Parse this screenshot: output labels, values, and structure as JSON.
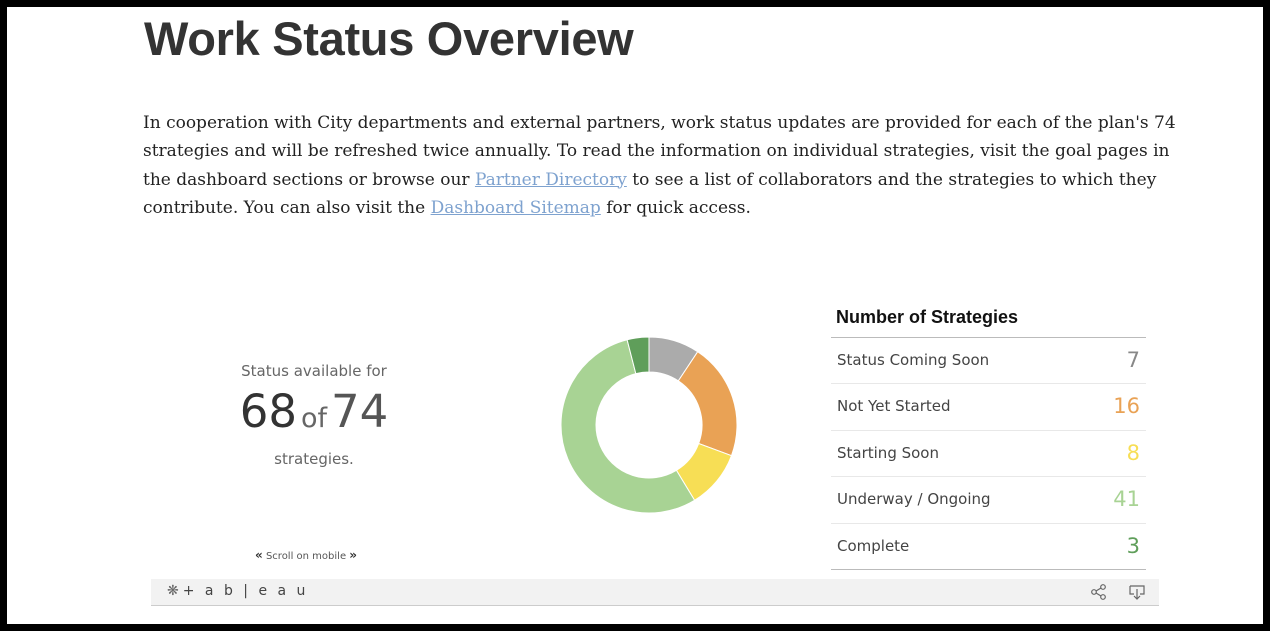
{
  "title": "Work Status Overview",
  "intro": {
    "part1": "In cooperation with City departments and external partners, work status updates are provided for each of the plan's 74 strategies and will be refreshed twice annually. To read the information on individual strategies, visit the goal pages in the dashboard sections or browse our ",
    "link1": "Partner Directory",
    "part2": " to see a list of collaborators and the strategies to which they contribute. You can also visit the ",
    "link2": "Dashboard Sitemap",
    "part3": " for quick access."
  },
  "availability": {
    "label": "Status available for",
    "count": "68",
    "of_word": "of",
    "total": "74",
    "suffix": "strategies."
  },
  "scroll_hint": {
    "left_glyph": "«",
    "text": "Scroll on mobile",
    "right_glyph": "»"
  },
  "chart_data": {
    "type": "pie",
    "donut": true,
    "title": "Number of Strategies",
    "categories": [
      "Status Coming Soon",
      "Not Yet Started",
      "Starting Soon",
      "Underway / Ongoing",
      "Complete"
    ],
    "values": [
      7,
      16,
      8,
      41,
      3
    ],
    "display_values": [
      "7",
      "16",
      "8",
      "41",
      "3"
    ],
    "colors": [
      "#ababab",
      "#e9a255",
      "#f7de55",
      "#a8d394",
      "#5f9e5a"
    ]
  },
  "toolbar": {
    "logo_text": "+ a b | e a u",
    "icons": [
      "tableau-logo-icon",
      "share-icon",
      "download-icon"
    ]
  }
}
